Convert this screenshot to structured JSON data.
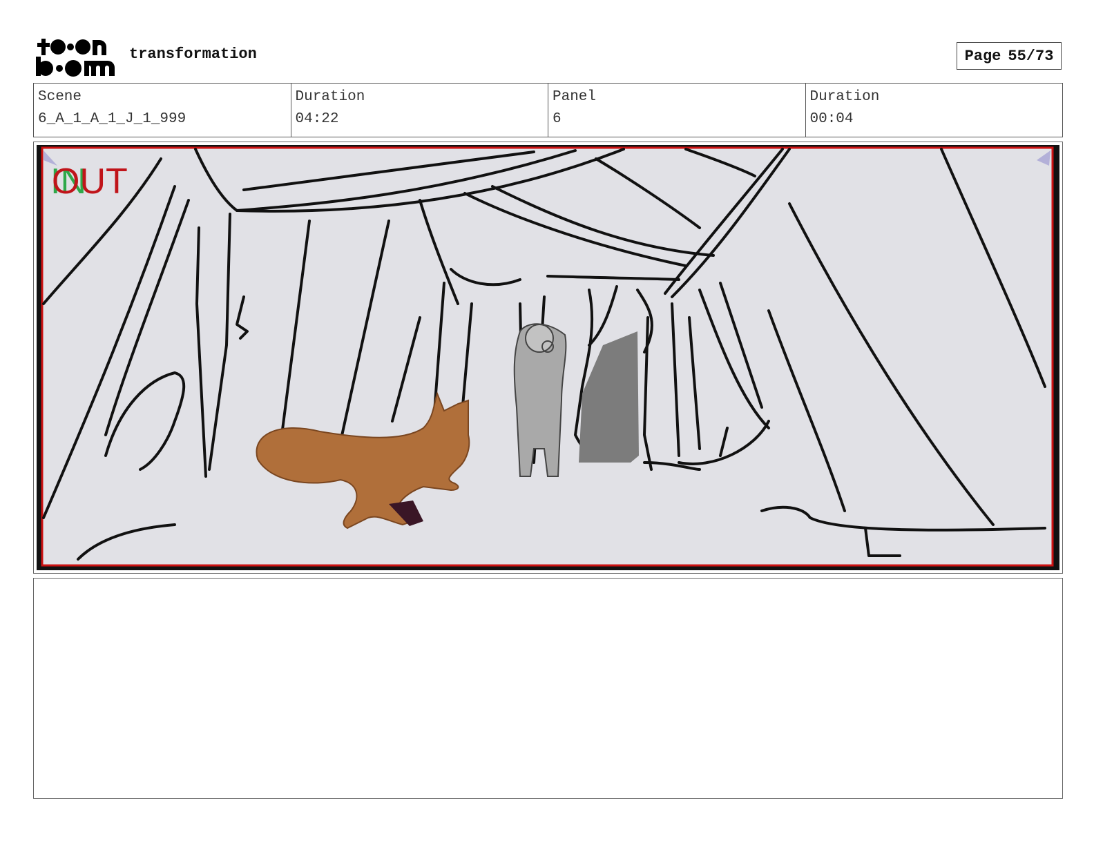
{
  "header": {
    "logo_text": "toon boom",
    "title": "transformation",
    "page_label": "Page",
    "page_value": "55/73"
  },
  "info": {
    "scene_label": "Scene",
    "scene_value": "6_A_1_A_1_J_1_999",
    "scene_duration_label": "Duration",
    "scene_duration_value": "04:22",
    "panel_label": "Panel",
    "panel_value": "6",
    "panel_duration_label": "Duration",
    "panel_duration_value": "00:04"
  },
  "panel": {
    "in_marker": "IN",
    "out_marker": "OUT",
    "colors": {
      "background": "#e1e1e6",
      "frame_red": "#cc1111",
      "fox": "#b06f3a",
      "fox_dark": "#3a1626",
      "figure": "#a9a9a9",
      "doorway": "#7c7c7c",
      "in_green": "#2fa84a",
      "out_red": "#c0141a"
    }
  },
  "notes": {
    "text": ""
  }
}
